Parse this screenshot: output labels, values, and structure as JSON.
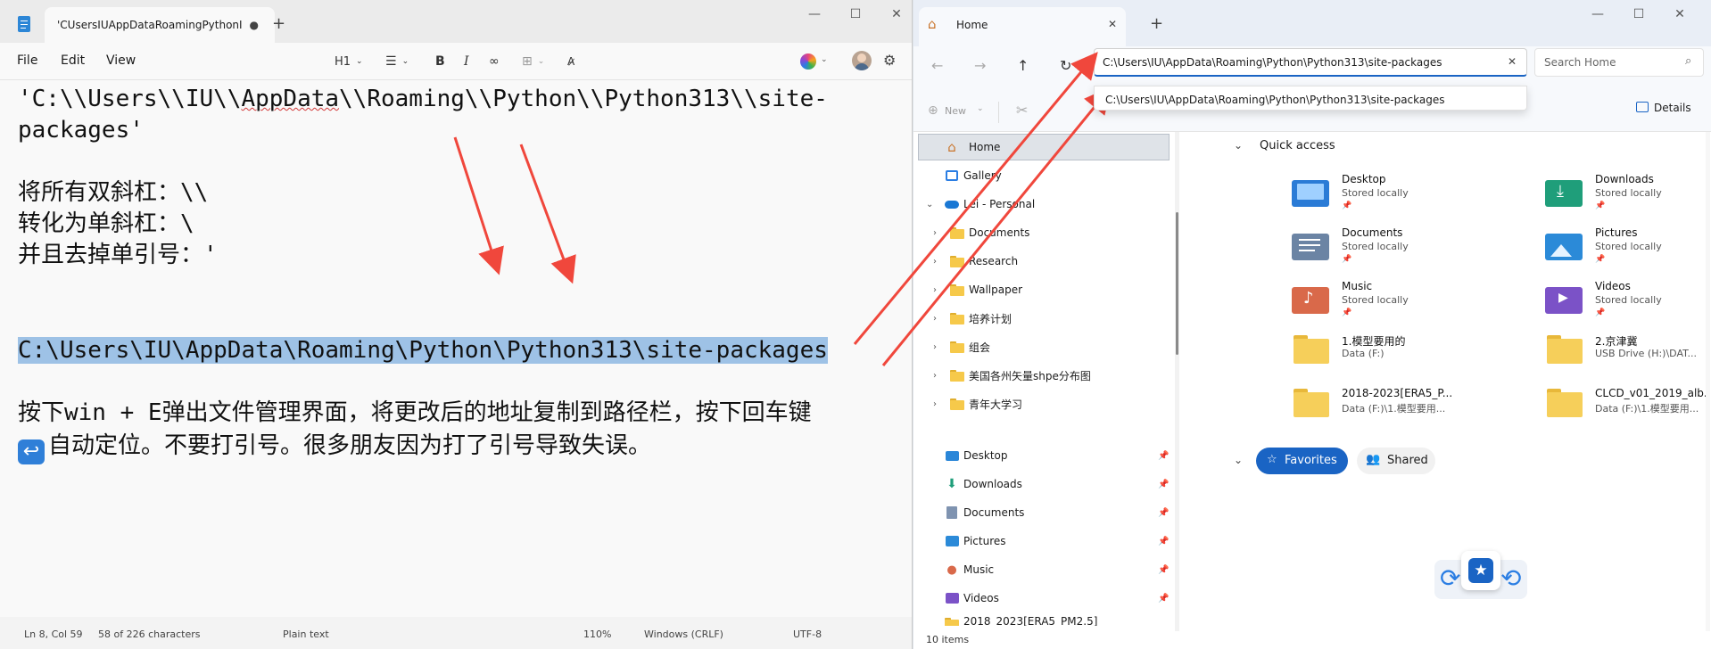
{
  "notepad": {
    "tab_title": "'CUsersIUAppDataRoamingPythonI",
    "tab_dot": "●",
    "menus": [
      "File",
      "Edit",
      "View"
    ],
    "heading_label": "H1",
    "lines": [
      "'C:\\\\Users\\\\IU\\\\AppData\\\\Roaming\\\\Python\\\\Python313\\\\site-",
      "packages'",
      "将所有双斜杠：\\\\",
      "转化为单斜杠：\\",
      "并且去掉单引号：'",
      "C:\\Users\\IU\\AppData\\Roaming\\Python\\Python313\\site-packages",
      "按下win + E弹出文件管理界面，将更改后的地址复制到路径栏，按下回车键",
      "自动定位。不要打引号。很多朋友因为打了引号导致失误。"
    ],
    "line1_parts": [
      "'C:\\\\Users\\\\IU\\\\",
      "AppData",
      "\\\\Roaming\\\\Python\\\\Python313\\\\site-"
    ],
    "status": {
      "position": "Ln 8, Col 59",
      "chars": "58 of 226 characters",
      "format": "Plain text",
      "zoom": "110%",
      "line_ending": "Windows (CRLF)",
      "encoding": "UTF-8"
    }
  },
  "explorer": {
    "tab_title": "Home",
    "address_value": "C:\\Users\\IU\\AppData\\Roaming\\Python\\Python313\\site-packages",
    "suggestion": "C:\\Users\\IU\\AppData\\Roaming\\Python\\Python313\\site-packages",
    "search_placeholder": "Search Home",
    "new_label": "New",
    "more_label": "...",
    "details_label": "Details",
    "nav": {
      "home": "Home",
      "gallery": "Gallery",
      "onedrive": "Lei - Personal",
      "folders": [
        "Documents",
        "Research",
        "Wallpaper",
        "培养计划",
        "组会",
        "美国各州矢量shpe分布图",
        "青年大学习"
      ],
      "pinned": [
        "Desktop",
        "Downloads",
        "Documents",
        "Pictures",
        "Music",
        "Videos"
      ],
      "partial": "2018_2023[ERA5_PM2.5]"
    },
    "quick_access_label": "Quick access",
    "quick_access": [
      {
        "name": "Desktop",
        "sub": "Stored locally",
        "icon": "desktop-folder-icon",
        "color": "#2a7bd6"
      },
      {
        "name": "Downloads",
        "sub": "Stored locally",
        "icon": "downloads-folder-icon",
        "color": "#1f9e7a"
      },
      {
        "name": "Documents",
        "sub": "Stored locally",
        "icon": "documents-folder-icon",
        "color": "#6b84a4"
      },
      {
        "name": "Pictures",
        "sub": "Stored locally",
        "icon": "pictures-folder-icon",
        "color": "#2b8ad8"
      },
      {
        "name": "Music",
        "sub": "Stored locally",
        "icon": "music-folder-icon",
        "color": "#d9694a"
      },
      {
        "name": "Videos",
        "sub": "Stored locally",
        "icon": "videos-folder-icon",
        "color": "#7b52c7"
      },
      {
        "name": "1.模型要用的",
        "sub": "Data (F:)",
        "icon": "folder-icon",
        "color": "#f6cf5a"
      },
      {
        "name": "2.京津冀",
        "sub": "USB Drive (H:)\\DAT...",
        "icon": "folder-icon",
        "color": "#f6cf5a"
      },
      {
        "name": "2018-2023[ERA5_P...",
        "sub": "Data (F:)\\1.模型要用...",
        "icon": "folder-icon",
        "color": "#f6cf5a"
      },
      {
        "name": "CLCD_v01_2019_alb...",
        "sub": "Data (F:)\\1.模型要用...",
        "icon": "folder-icon",
        "color": "#f6cf5a"
      }
    ],
    "favorites_label": "Favorites",
    "shared_label": "Shared",
    "items_count": "10 items"
  },
  "colors": {
    "selection": "#9ec2e6",
    "arrow": "#f0473c",
    "accent": "#1a64c4"
  }
}
